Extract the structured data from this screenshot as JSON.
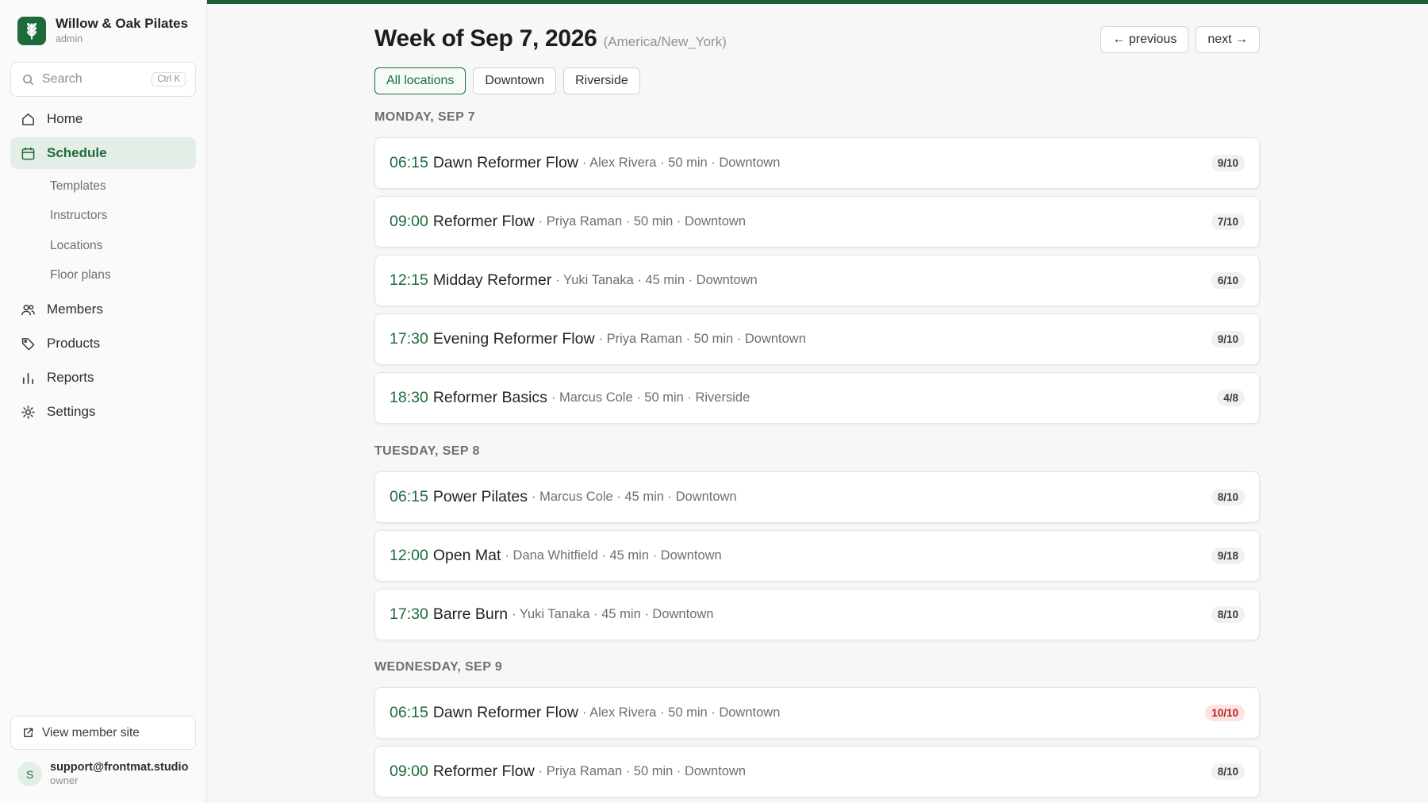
{
  "brand": {
    "name": "Willow & Oak Pilates",
    "role": "admin"
  },
  "search": {
    "placeholder": "Search",
    "shortcut": "Ctrl K"
  },
  "nav": {
    "home": "Home",
    "schedule": "Schedule",
    "sub": [
      "Templates",
      "Instructors",
      "Locations",
      "Floor plans"
    ],
    "members": "Members",
    "products": "Products",
    "reports": "Reports",
    "settings": "Settings"
  },
  "footer": {
    "view_site": "View member site",
    "user_initial": "S",
    "user_email": "support@frontmat.studio",
    "user_role": "owner"
  },
  "header": {
    "title": "Week of Sep 7, 2026",
    "timezone": "(America/New_York)",
    "prev": "← previous",
    "next": "next →"
  },
  "filters": [
    "All locations",
    "Downtown",
    "Riverside"
  ],
  "days": [
    {
      "label": "MONDAY, SEP 7",
      "classes": [
        {
          "time": "06:15",
          "name": "Dawn Reformer Flow",
          "meta": "· Alex Rivera · 50 min · Downtown",
          "count": "9/10"
        },
        {
          "time": "09:00",
          "name": "Reformer Flow",
          "meta": "· Priya Raman · 50 min · Downtown",
          "count": "7/10"
        },
        {
          "time": "12:15",
          "name": "Midday Reformer",
          "meta": "· Yuki Tanaka · 45 min · Downtown",
          "count": "6/10"
        },
        {
          "time": "17:30",
          "name": "Evening Reformer Flow",
          "meta": "· Priya Raman · 50 min · Downtown",
          "count": "9/10"
        },
        {
          "time": "18:30",
          "name": "Reformer Basics",
          "meta": "· Marcus Cole · 50 min · Riverside",
          "count": "4/8"
        }
      ]
    },
    {
      "label": "TUESDAY, SEP 8",
      "classes": [
        {
          "time": "06:15",
          "name": "Power Pilates",
          "meta": "· Marcus Cole · 45 min · Downtown",
          "count": "8/10"
        },
        {
          "time": "12:00",
          "name": "Open Mat",
          "meta": "· Dana Whitfield · 45 min · Downtown",
          "count": "9/18"
        },
        {
          "time": "17:30",
          "name": "Barre Burn",
          "meta": "· Yuki Tanaka · 45 min · Downtown",
          "count": "8/10"
        }
      ]
    },
    {
      "label": "WEDNESDAY, SEP 9",
      "classes": [
        {
          "time": "06:15",
          "name": "Dawn Reformer Flow",
          "meta": "· Alex Rivera · 50 min · Downtown",
          "count": "10/10"
        },
        {
          "time": "09:00",
          "name": "Reformer Flow",
          "meta": "· Priya Raman · 50 min · Downtown",
          "count": "8/10"
        }
      ]
    }
  ],
  "colors": {
    "accent": "#1d6b3c",
    "full_badge": "#b3261e"
  }
}
